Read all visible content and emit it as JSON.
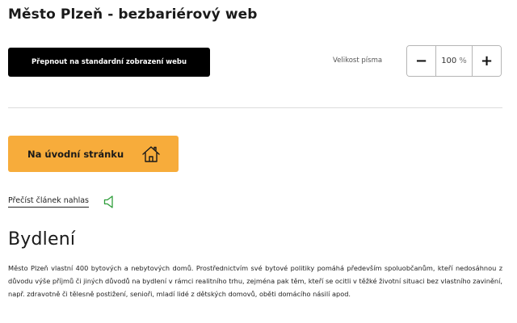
{
  "header": {
    "site_title": "Město Plzeň - bezbariérový web"
  },
  "toolbar": {
    "switch_view_label": "Přepnout na standardní zobrazení webu",
    "font_size_label": "Velikost písma",
    "font_size": {
      "decrease_label": "−",
      "value": "100",
      "unit": "%",
      "increase_label": "+"
    }
  },
  "navigation": {
    "home_label": "Na úvodní stránku",
    "home_icon": "home-icon"
  },
  "read_aloud": {
    "label": "Přečíst článek nahlas",
    "icon": "speaker-icon",
    "icon_color": "#2e9e3a"
  },
  "article": {
    "heading": "Bydlení",
    "body": "Město Plzeň vlastní 400 bytových a nebytových domů. Prostřednictvím své bytové politiky pomáhá především spoluobčanům, kteří nedosáhnou z důvodu výše příjmů či jiných důvodů na bydlení v rámci realitního trhu, zejména pak těm, kteří se ocitli v těžké životní situaci bez vlastního zavinění, např. zdravotně či tělesně postižení, senioři, mladí lidé z dětských domovů, oběti domácího násilí apod."
  },
  "colors": {
    "accent": "#f7ac3b",
    "switch_button_bg": "#000000",
    "divider": "#dcdcdc"
  }
}
